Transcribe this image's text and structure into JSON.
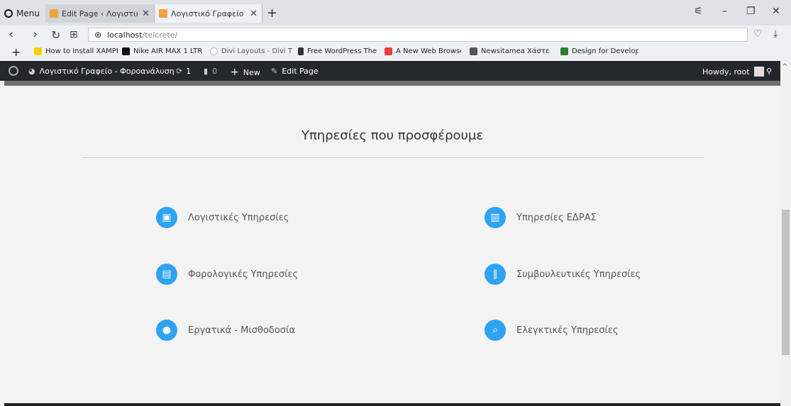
{
  "browser": {
    "menu_label": "Menu",
    "tabs": [
      {
        "title": "Edit Page ‹ Λογιστικό Γραφ",
        "close": "✕"
      },
      {
        "title": "Λογιστικό Γραφείο – Φορ",
        "close": "✕"
      }
    ],
    "new_tab": "+",
    "window_controls": {
      "menu": "⚟",
      "minimize": "–",
      "restore": "❐",
      "close": "✕"
    },
    "nav": {
      "back": "‹",
      "forward": "›",
      "reload": "↻",
      "speed_dial": "⊞"
    },
    "url_host": "localhost",
    "url_path": "/teicrete/",
    "heart": "♡",
    "download": "⤓",
    "bookmarks": [
      {
        "label": "How to Install XAMPP",
        "icon": "xampp-icon",
        "color": "#f5d000"
      },
      {
        "label": "Nike AIR MAX 1 LTR",
        "icon": "nike-icon",
        "color": "#111111"
      },
      {
        "label": "Divi Layouts - Divi Th",
        "icon": "divi-icon",
        "color": "#bbbbbb"
      },
      {
        "label": "Free WordPress Them",
        "icon": "document-icon",
        "color": "#333333"
      },
      {
        "label": "A New Web Browser",
        "icon": "vivaldi-icon",
        "color": "#ef3939"
      },
      {
        "label": "Newsitamea Χάστε β",
        "icon": "newsitamea-icon",
        "color": "#555555"
      },
      {
        "label": "Design for Developer",
        "icon": "design-icon",
        "color": "#2e7d32"
      }
    ],
    "bookmark_add": "+"
  },
  "wp_admin_bar": {
    "site_name": "Λογιστικό Γραφείο - Φοροανάλυση",
    "updates": "1",
    "comments": "0",
    "new_label": "New",
    "edit_label": "Edit Page",
    "howdy": "Howdy, root"
  },
  "main": {
    "section_title": "Υπηρεσίες που προσφέρουμε",
    "services": [
      {
        "label": "Λογιστικές Υπηρεσίες",
        "icon": "presentation-chart-icon"
      },
      {
        "label": "Υπηρεσίες ΕΔΡΑΣ",
        "icon": "building-icon"
      },
      {
        "label": "Φορολογικές Υπηρεσίες",
        "icon": "document-icon"
      },
      {
        "label": "Συμβουλευτικές Υπηρεσίες",
        "icon": "tools-icon"
      },
      {
        "label": "Εργατικά - Μισθοδοσία",
        "icon": "users-icon"
      },
      {
        "label": "Ελεγκτικές Υπηρεσίες",
        "icon": "document-search-icon"
      }
    ]
  },
  "colors": {
    "accent": "#2ea3f2",
    "admin_bar": "#23282d"
  }
}
